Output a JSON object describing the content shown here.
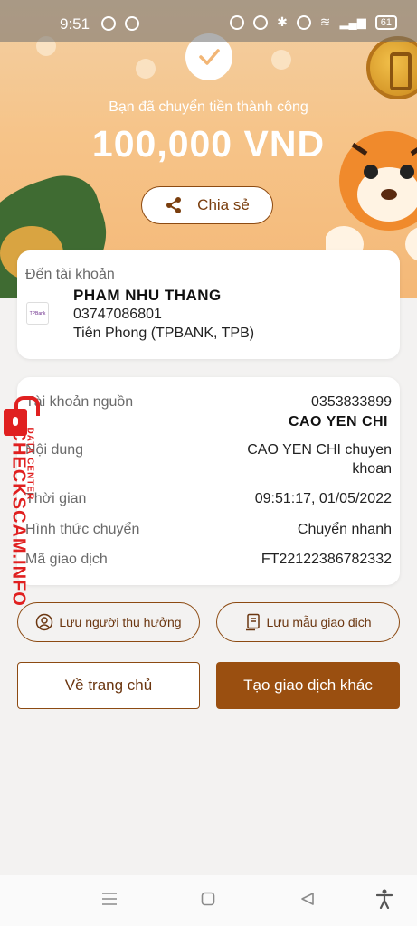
{
  "status_bar": {
    "time": "9:51",
    "battery": "61"
  },
  "hero": {
    "success_message": "Bạn đã chuyển tiền thành công",
    "amount": "100,000 VND",
    "share_label": "Chia sẻ"
  },
  "recipient": {
    "label": "Đến tài khoản",
    "bank_logo_text": "TPBank",
    "name": "PHAM NHU THANG",
    "account": "03747086801",
    "bank": "Tiên Phong (TPBANK, TPB)"
  },
  "details": {
    "source_label": "Tài khoản nguồn",
    "source_account": "0353833899",
    "source_name": "CAO YEN CHI",
    "content_label": "Nội dung",
    "content_value_line1": "CAO YEN CHI chuyen",
    "content_value_line2": "khoan",
    "time_label": "Thời gian",
    "time_value": "09:51:17, 01/05/2022",
    "method_label": "Hình thức chuyển",
    "method_value": "Chuyển nhanh",
    "txn_label": "Mã giao dịch",
    "txn_value": "FT22122386782332"
  },
  "actions": {
    "save_beneficiary": "Lưu người thụ hưởng",
    "save_template": "Lưu mẫu giao dịch",
    "home": "Về trang chủ",
    "new_transaction": "Tạo giao dịch khác"
  },
  "watermark": {
    "brand": "CHECKSCAM.INFO",
    "sub": "DATA CENTER"
  },
  "colors": {
    "accent": "#9a4f10",
    "hero": "#f6c489",
    "watermark": "#e02020"
  },
  "icons": [
    "check-icon",
    "share-icon",
    "user-circle-icon",
    "document-icon",
    "menu-icon",
    "home-square-icon",
    "back-triangle-icon",
    "accessibility-icon"
  ]
}
